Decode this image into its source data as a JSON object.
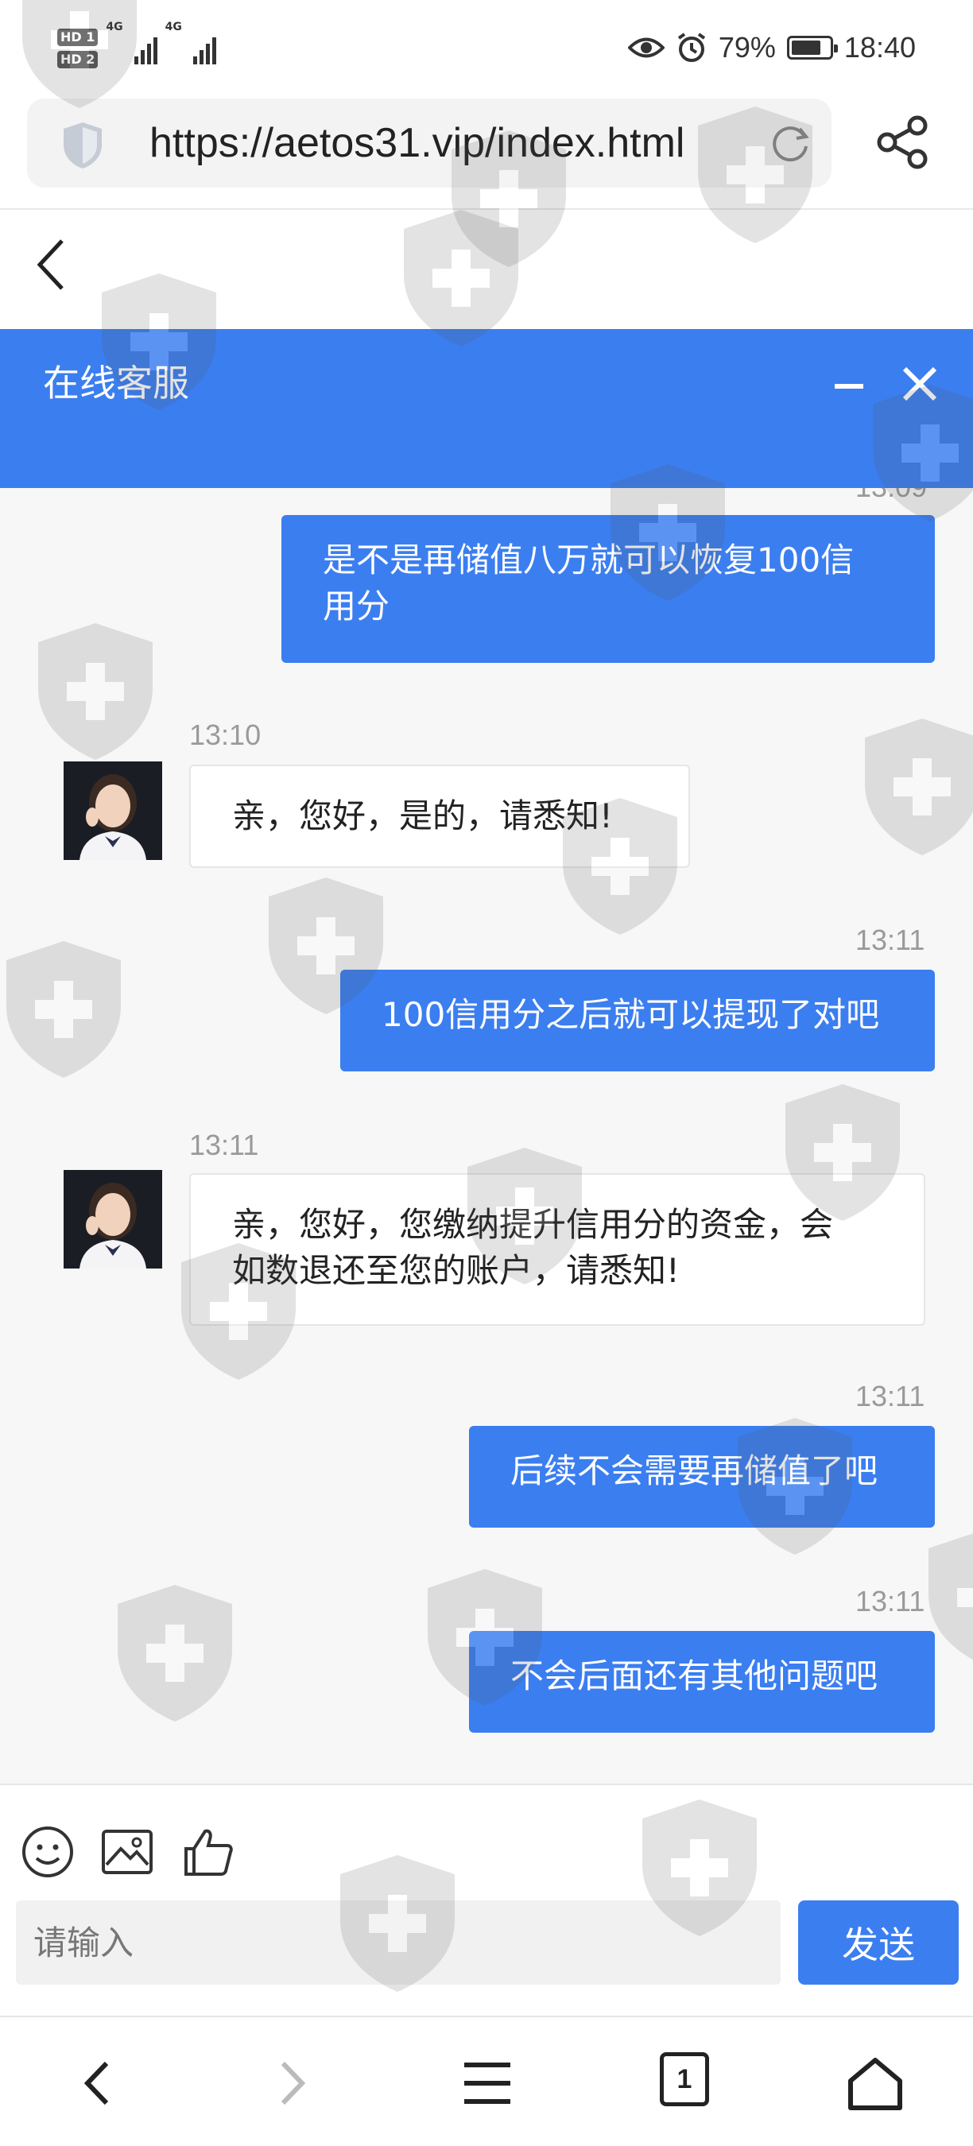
{
  "status_bar": {
    "sim1": "HD 1",
    "sim2": "HD 2",
    "network1": "4G",
    "network2": "4G",
    "battery_percent": "79%",
    "battery_level": 0.79,
    "time": "18:40"
  },
  "browser": {
    "url": "https://aetos31.vip/index.html",
    "tab_count": "1"
  },
  "chat": {
    "title": "在线客服",
    "partial_timestamp": "13:09",
    "messages": [
      {
        "side": "out",
        "time": "",
        "text_line1": "是不是再储值八万就可以恢复100信",
        "text_line2": "用分"
      },
      {
        "side": "in",
        "time": "13:10",
        "text_line1": "亲，您好，是的，请悉知!",
        "text_line2": ""
      },
      {
        "side": "out",
        "time": "13:11",
        "text_line1": "100信用分之后就可以提现了对吧",
        "text_line2": ""
      },
      {
        "side": "in",
        "time": "13:11",
        "text_line1": "亲，您好，您缴纳提升信用分的资金，会",
        "text_line2": "如数退还至您的账户，请悉知!"
      },
      {
        "side": "out",
        "time": "13:11",
        "text_line1": "后续不会需要再储值了吧",
        "text_line2": ""
      },
      {
        "side": "out",
        "time": "13:11",
        "text_line1": "不会后面还有其他问题吧",
        "text_line2": ""
      }
    ]
  },
  "composer": {
    "placeholder": "请输入",
    "send_label": "发送"
  },
  "icons": [
    "shield-icon",
    "reload-icon",
    "share-icon",
    "back-arrow-icon",
    "minimize-icon",
    "close-icon",
    "emoji-icon",
    "image-icon",
    "thumbs-up-icon",
    "nav-back-icon",
    "nav-forward-icon",
    "menu-icon",
    "home-icon"
  ],
  "colors": {
    "accent": "#3b7ef0",
    "chat_bg": "#f7f7f7"
  }
}
